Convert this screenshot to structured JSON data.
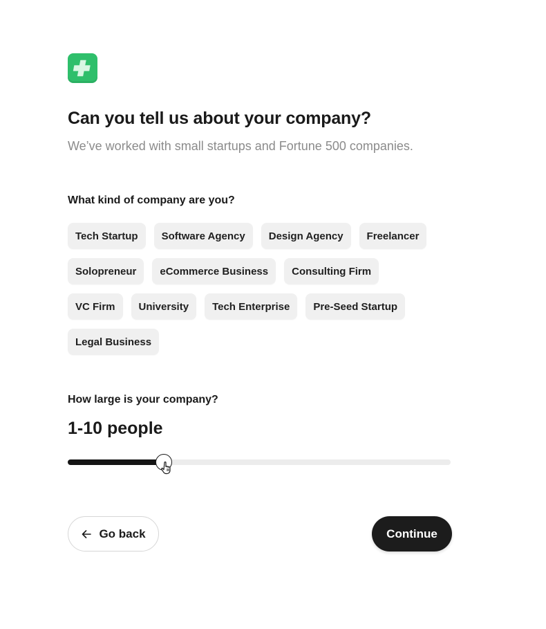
{
  "brand": {
    "logo_icon": "plus-icon",
    "logo_color": "#2fbf6b"
  },
  "header": {
    "title": "Can you tell us about your company?",
    "subtitle": "We’ve worked with small startups and Fortune 500 companies."
  },
  "company_type": {
    "label": "What kind of company are you?",
    "options": [
      "Tech Startup",
      "Software Agency",
      "Design Agency",
      "Freelancer",
      "Solopreneur",
      "eCommerce Business",
      "Consulting Firm",
      "VC Firm",
      "University",
      "Tech Enterprise",
      "Pre-Seed Startup",
      "Legal Business"
    ]
  },
  "company_size": {
    "label": "How large is your company?",
    "value_text": "1-10 people",
    "slider_fraction": 0.25
  },
  "actions": {
    "back_label": "Go back",
    "back_icon": "arrow-left-icon",
    "continue_label": "Continue"
  },
  "colors": {
    "accent": "#2fbf6b",
    "primary_button": "#1c1c1c",
    "chip_background": "#f0f0f0",
    "muted_text": "#8b8b8b"
  }
}
